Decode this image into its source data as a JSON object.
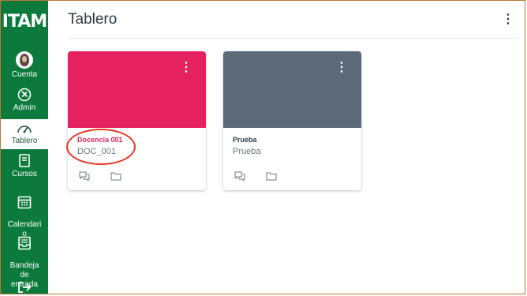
{
  "app": {
    "logo_text": "ITAM"
  },
  "sidebar": {
    "items": [
      {
        "label": "Cuenta",
        "icon": "user-avatar-icon"
      },
      {
        "label": "Admin",
        "icon": "shield-icon"
      },
      {
        "label": "Tablero",
        "icon": "dashboard-gauge-icon",
        "active": true
      },
      {
        "label": "Cursos",
        "icon": "book-icon"
      },
      {
        "label": "Calendari\no",
        "icon": "calendar-icon"
      },
      {
        "label": "Bandeja\nde\nentrada",
        "icon": "inbox-icon"
      },
      {
        "label": "",
        "icon": "logout-arrow-icon"
      }
    ]
  },
  "header": {
    "title": "Tablero"
  },
  "cards": [
    {
      "title": "Docencia 001",
      "code": "DOC_001",
      "color": "#e6215f",
      "title_color": "#e6215f"
    },
    {
      "title": "Prueba",
      "code": "Prueba",
      "color": "#5c6a77",
      "title_color": "#2d3b45"
    }
  ],
  "colors": {
    "sidebar_bg": "#0b7a3c",
    "annotation_circle": "#e63322"
  }
}
